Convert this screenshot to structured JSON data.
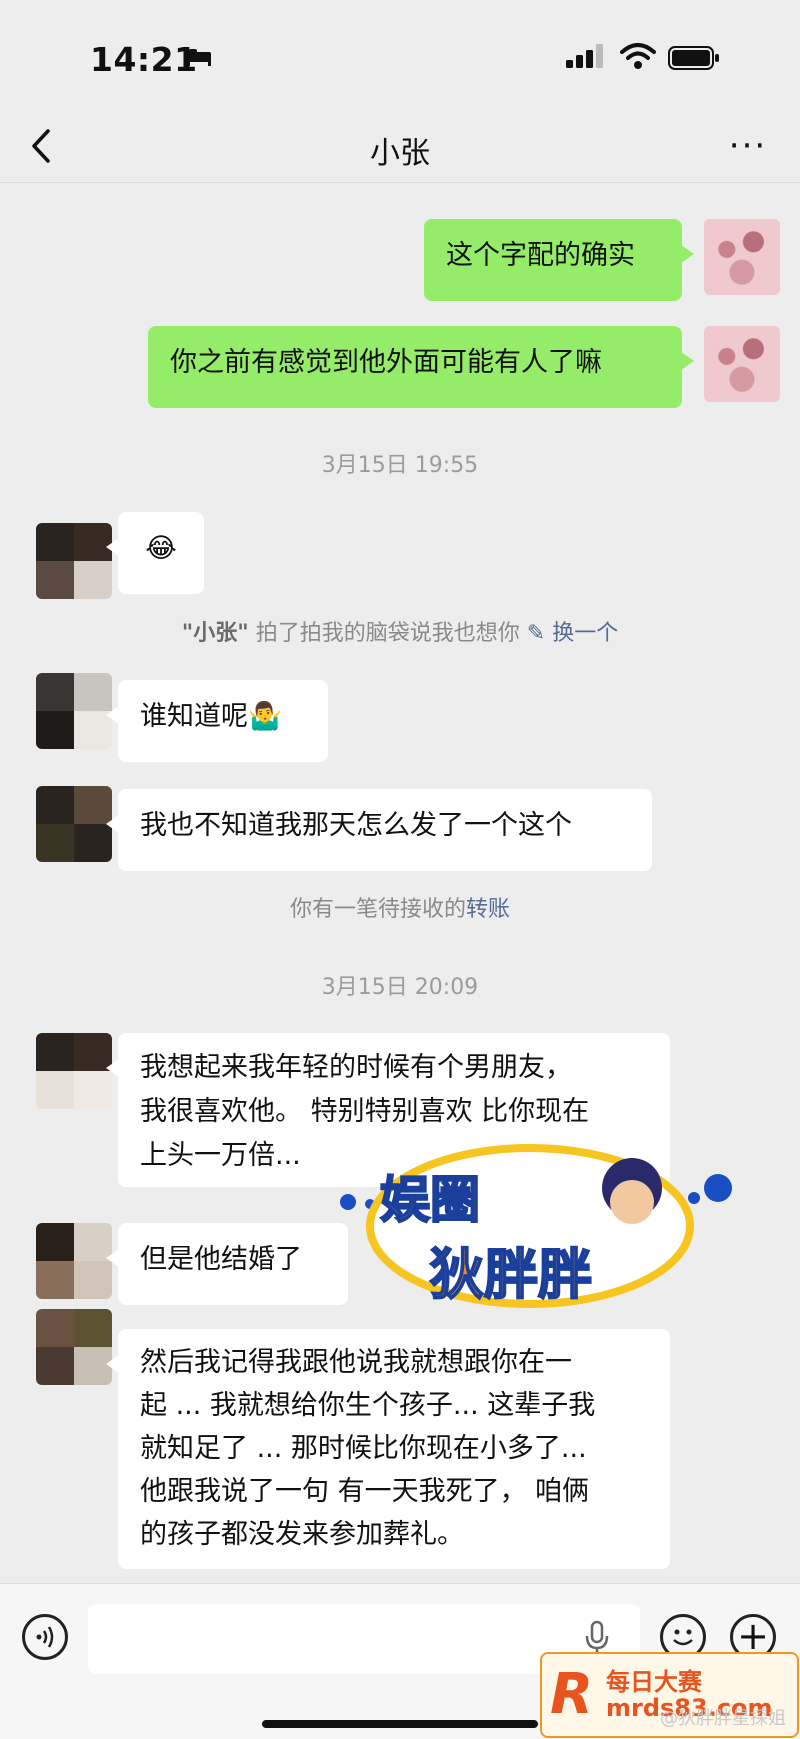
{
  "status_bar": {
    "time": "14:21"
  },
  "header": {
    "title": "小张"
  },
  "messages": [
    {
      "side": "right",
      "text": "这个字配的确实"
    },
    {
      "side": "right",
      "text": "你之前有感觉到他外面可能有人了嘛"
    },
    {
      "timestamp": "3月15日 19:55"
    },
    {
      "side": "left",
      "text": "😂"
    },
    {
      "system": {
        "name": "\"小张\"",
        "action": "拍了拍我的脑袋说我也想你",
        "link": "换一个"
      }
    },
    {
      "side": "left",
      "text": "谁知道呢🤷‍♂️"
    },
    {
      "side": "left",
      "text": "我也不知道我那天怎么发了一个这个"
    },
    {
      "system2": {
        "text": "你有一笔待接收的",
        "link": "转账"
      }
    },
    {
      "timestamp": "3月15日 20:09"
    },
    {
      "side": "left",
      "text": "我想起来我年轻的时候有个男朋友，\n我很喜欢他。 特别特别喜欢 比你现在\n上头一万倍..."
    },
    {
      "side": "left",
      "text": "但是他结婚了"
    },
    {
      "side": "left",
      "text": "然后我记得我跟他说我就想跟你在一\n起 ... 我就想给你生个孩子... 这辈子我\n就知足了 ... 那时候比你现在小多了...\n他跟我说了一句 有一天我死了， 咱俩\n的孩子都没发来参加葬礼。"
    }
  ],
  "watermarks": {
    "sticker_line1": "娱圈",
    "sticker_line2": "狄胖胖",
    "badge_line1": "每日大赛",
    "badge_line2": "mrds83.com",
    "weibo": "@狄胖胖星探姐"
  },
  "colors": {
    "sent_bubble": "#95ec69",
    "received_bubble": "#ffffff",
    "link": "#576b95",
    "background": "#ededed"
  }
}
